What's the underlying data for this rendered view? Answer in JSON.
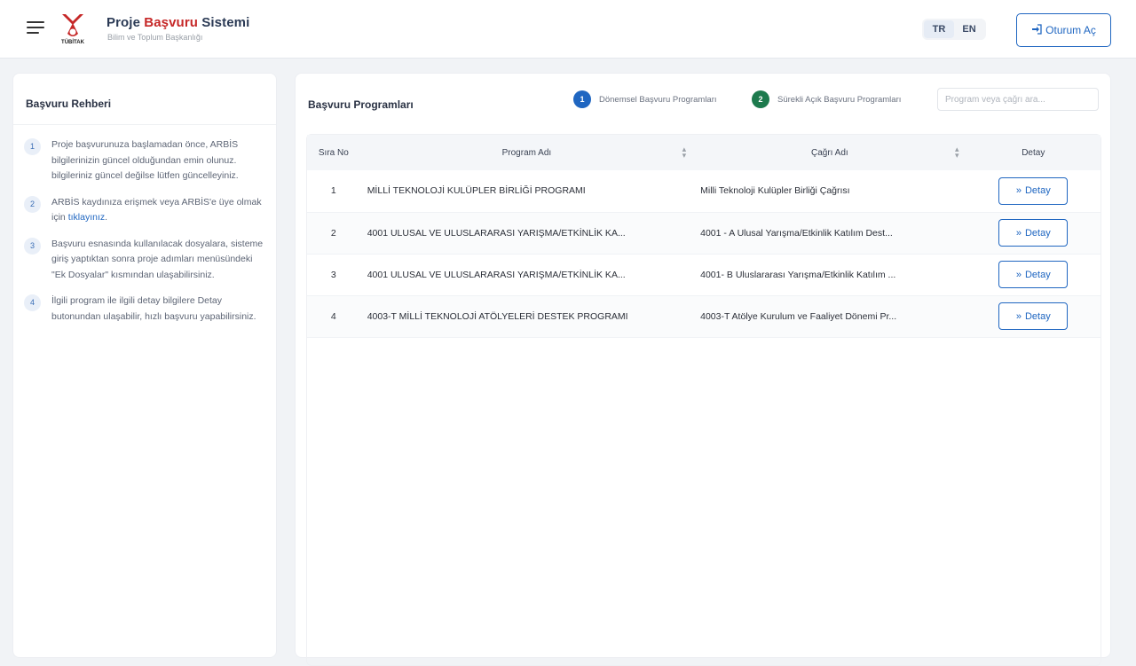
{
  "header": {
    "title_part1": "Proje ",
    "title_accent": "Başvuru",
    "title_part2": " Sistemi",
    "subtitle": "Bilim ve Toplum Başkanlığı",
    "logo_text": "TÜBİTAK",
    "languages": [
      "TR",
      "EN"
    ],
    "login_label": "Oturum Aç"
  },
  "guide": {
    "title": "Başvuru Rehberi",
    "items": [
      {
        "num": "1",
        "text": "Proje başvurunuza başlamadan önce, ARBİS bilgilerinizin güncel olduğundan emin olunuz. bilgileriniz güncel değilse lütfen güncelleyiniz."
      },
      {
        "num": "2",
        "text_before": "ARBİS kaydınıza erişmek veya ARBİS'e üye olmak için ",
        "link": "tıklayınız",
        "text_after": "."
      },
      {
        "num": "3",
        "text": "Başvuru esnasında kullanılacak dosyalara, sisteme giriş yaptıktan sonra proje adımları menüsündeki \"Ek Dosyalar\" kısmından ulaşabilirsiniz."
      },
      {
        "num": "4",
        "text": "İlgili program ile ilgili detay bilgilere Detay butonundan ulaşabilir, hızlı başvuru yapabilirsiniz."
      }
    ]
  },
  "main": {
    "title": "Başvuru Programları",
    "legend": [
      {
        "num": "1",
        "label": "Dönemsel Başvuru Programları"
      },
      {
        "num": "2",
        "label": "Sürekli Açık Başvuru Programları"
      }
    ],
    "search_placeholder": "Program veya çağrı ara...",
    "columns": [
      "Sıra No",
      "Program Adı",
      "Çağrı Adı",
      "Detay"
    ],
    "detail_label": "Detay",
    "rows": [
      {
        "no": "1",
        "program": "MİLLİ TEKNOLOJİ KULÜPLER BİRLİĞİ PROGRAMI",
        "cagri": "Milli Teknoloji Kulüpler Birliği Çağrısı"
      },
      {
        "no": "2",
        "program": "4001 ULUSAL VE ULUSLARARASI YARIŞMA/ETKİNLİK KA...",
        "cagri": "4001 - A Ulusal Yarışma/Etkinlik Katılım Dest..."
      },
      {
        "no": "3",
        "program": "4001 ULUSAL VE ULUSLARARASI YARIŞMA/ETKİNLİK KA...",
        "cagri": "4001- B Uluslararası Yarışma/Etkinlik Katılım ..."
      },
      {
        "no": "4",
        "program": "4003-T MİLLİ TEKNOLOJİ ATÖLYELERİ DESTEK PROGRAMI",
        "cagri": "4003-T Atölye Kurulum ve Faaliyet Dönemi Pr..."
      }
    ]
  },
  "colors": {
    "primary": "#1f66c1",
    "accent_red": "#c62828",
    "legend_green": "#1d7a4d"
  }
}
